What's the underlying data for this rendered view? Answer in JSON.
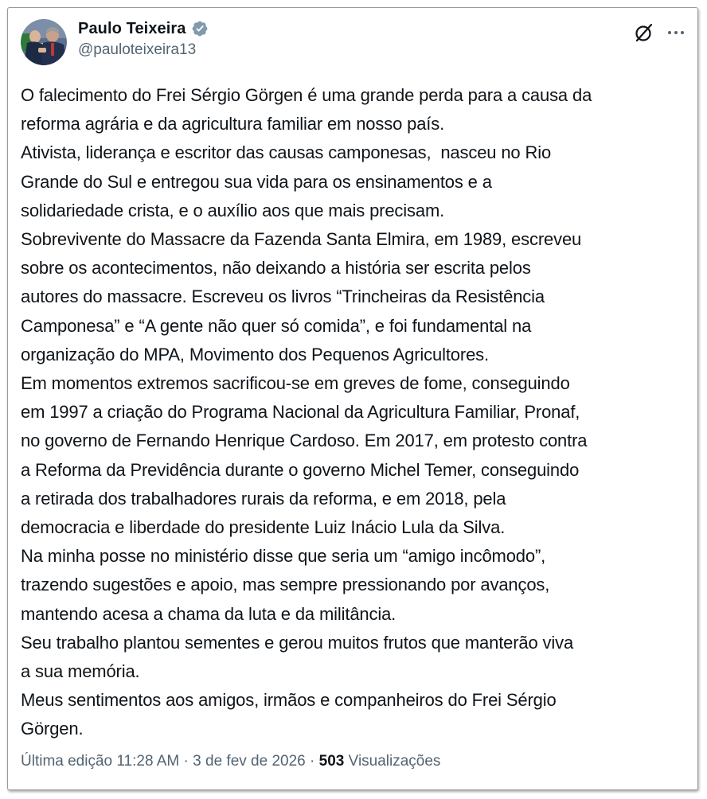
{
  "author": {
    "display_name": "Paulo Teixeira",
    "handle": "@pauloteixeira13",
    "verified": true
  },
  "icons": {
    "avatar": "profile-photo",
    "verified": "verified-badge-icon",
    "grok": "grok-icon",
    "more": "more-options-icon"
  },
  "colors": {
    "text_primary": "#0f1419",
    "text_secondary": "#536471",
    "verified_badge": "#829aab"
  },
  "post": {
    "lines": [
      "O falecimento do Frei Sérgio Görgen é uma grande perda para a causa da",
      "reforma agrária e da agricultura familiar em nosso país.",
      "Ativista, liderança e escritor das causas camponesas,  nasceu no Rio",
      "Grande do Sul e entregou sua vida para os ensinamentos e a",
      "solidariedade crista, e o auxílio aos que mais precisam.",
      "Sobrevivente do Massacre da Fazenda Santa Elmira, em 1989, escreveu",
      "sobre os acontecimentos, não deixando a história ser escrita pelos",
      "autores do massacre. Escreveu os livros “Trincheiras da Resistência",
      "Camponesa” e “A gente não quer só comida”, e foi fundamental na",
      "organização do MPA, Movimento dos Pequenos Agricultores.",
      "Em momentos extremos sacrificou-se em greves de fome, conseguindo",
      "em 1997 a criação do Programa Nacional da Agricultura Familiar, Pronaf,",
      "no governo de Fernando Henrique Cardoso. Em 2017, em protesto contra",
      "a Reforma da Previdência durante o governo Michel Temer, conseguindo",
      "a retirada dos trabalhadores rurais da reforma, e em 2018, pela",
      "democracia e liberdade do presidente Luiz Inácio Lula da Silva.",
      "Na minha posse no ministério disse que seria um “amigo incômodo”,",
      "trazendo sugestões e apoio, mas sempre pressionando por avanços,",
      "mantendo acesa a chama da luta e da militância.",
      "Seu trabalho plantou sementes e gerou muitos frutos que manterão viva",
      "a sua memória.",
      "Meus sentimentos aos amigos, irmãos e companheiros do Frei Sérgio",
      "Görgen."
    ]
  },
  "meta": {
    "edited_label": "Última edição",
    "time": "11:28 AM",
    "separator": "·",
    "date": "3 de fev de 2026",
    "views_count": "503",
    "views_label": "Visualizações"
  }
}
